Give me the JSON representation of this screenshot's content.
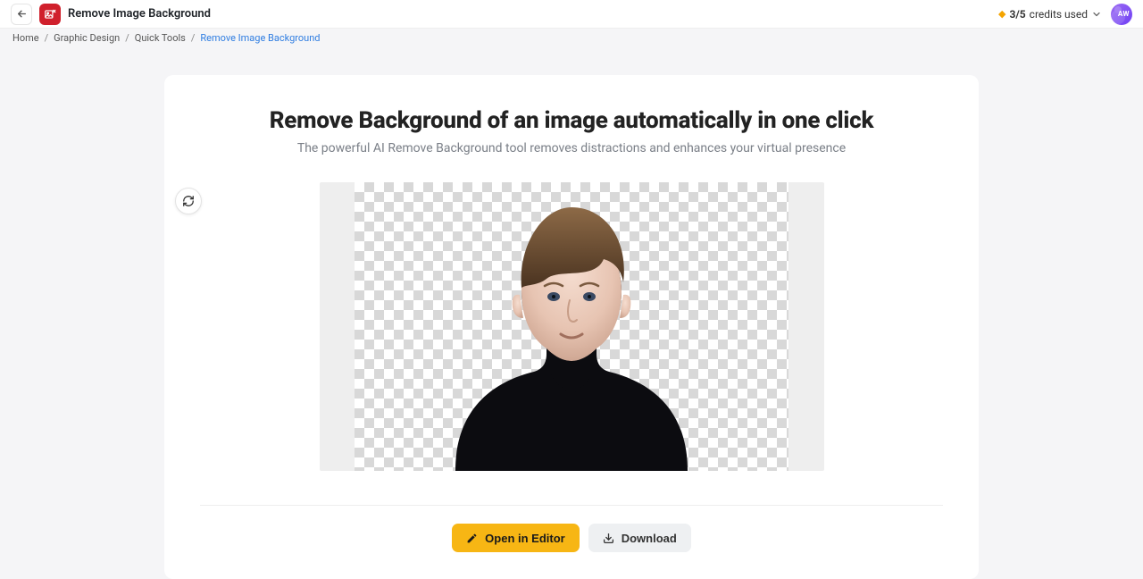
{
  "header": {
    "title": "Remove Image Background",
    "credits_count": "3/5",
    "credits_label": "credits used",
    "avatar_initials": "AW"
  },
  "breadcrumbs": {
    "items": [
      "Home",
      "Graphic Design",
      "Quick Tools",
      "Remove Image Background"
    ]
  },
  "hero": {
    "title": "Remove Background of an image automatically in one click",
    "subtitle": "The powerful AI Remove Background tool removes distractions and enhances your virtual presence"
  },
  "actions": {
    "open_editor_label": "Open in Editor",
    "download_label": "Download"
  }
}
